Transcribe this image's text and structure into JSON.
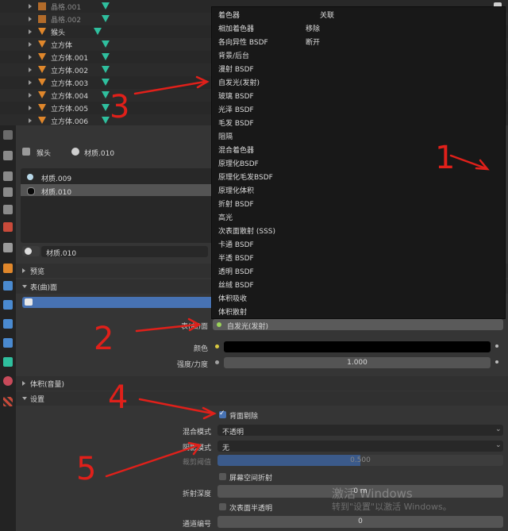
{
  "outliner": {
    "rows": [
      {
        "name": "晶格.001",
        "type": "lattice"
      },
      {
        "name": "晶格.002",
        "type": "lattice"
      },
      {
        "name": "猴头",
        "type": "mesh"
      },
      {
        "name": "立方体",
        "type": "mesh"
      },
      {
        "name": "立方体.001",
        "type": "mesh"
      },
      {
        "name": "立方体.002",
        "type": "mesh"
      },
      {
        "name": "立方体.003",
        "type": "mesh"
      },
      {
        "name": "立方体.004",
        "type": "mesh"
      },
      {
        "name": "立方体.005",
        "type": "mesh"
      },
      {
        "name": "立方体.006",
        "type": "mesh"
      }
    ]
  },
  "breadcrumb": {
    "object": "猴头",
    "material": "材质.010"
  },
  "material_slots": [
    "材质.009",
    "材质.010"
  ],
  "material_selector": "材质.010",
  "panels": {
    "preview": "预览",
    "surface": "表(曲)面",
    "volume": "体积(音量)",
    "settings": "设置"
  },
  "surface": {
    "label": "表(曲)面",
    "value": "自发光(发射)",
    "color_label": "颜色",
    "strength_label": "强度/力度",
    "strength_value": "1.000"
  },
  "settings": {
    "backface_label": "背面剔除",
    "blend_label": "混合模式",
    "blend_value": "不透明",
    "shadow_label": "阴影模式",
    "shadow_value": "无",
    "clip_label": "裁剪阈值",
    "clip_value": "0.500",
    "ssr_label": "屏幕空间折射",
    "refraction_label": "折射深度",
    "refraction_value": "0 m",
    "sss_label": "次表面半透明",
    "pass_label": "通道编号",
    "pass_value": "0"
  },
  "menu": {
    "col1": [
      "着色器",
      "相加着色器",
      "各向异性 BSDF",
      "背景/后台",
      "漫射 BSDF",
      "自发光(发射)",
      "玻璃 BSDF",
      "光泽 BSDF",
      "毛发 BSDF",
      "阻隔",
      "混合着色器",
      "原理化BSDF",
      "原理化毛发BSDF",
      "原理化体积",
      "折射 BSDF",
      "高光",
      "次表面散射 (SSS)",
      "卡通 BSDF",
      "半透 BSDF",
      "透明 BSDF",
      "丝绒 BSDF",
      "体积吸收",
      "体积散射"
    ],
    "col2": [
      "关联",
      "移除",
      "断开"
    ]
  },
  "watermark": {
    "line1": "激活 Windows",
    "line2": "转到\"设置\"以激活 Windows。"
  },
  "annotations": [
    "1",
    "2",
    "3",
    "4",
    "5"
  ],
  "colors": {
    "accent": "#4772b3",
    "annotation": "#e0201a",
    "mesh": "#e0872b",
    "modifier": "#2fbf9e"
  }
}
